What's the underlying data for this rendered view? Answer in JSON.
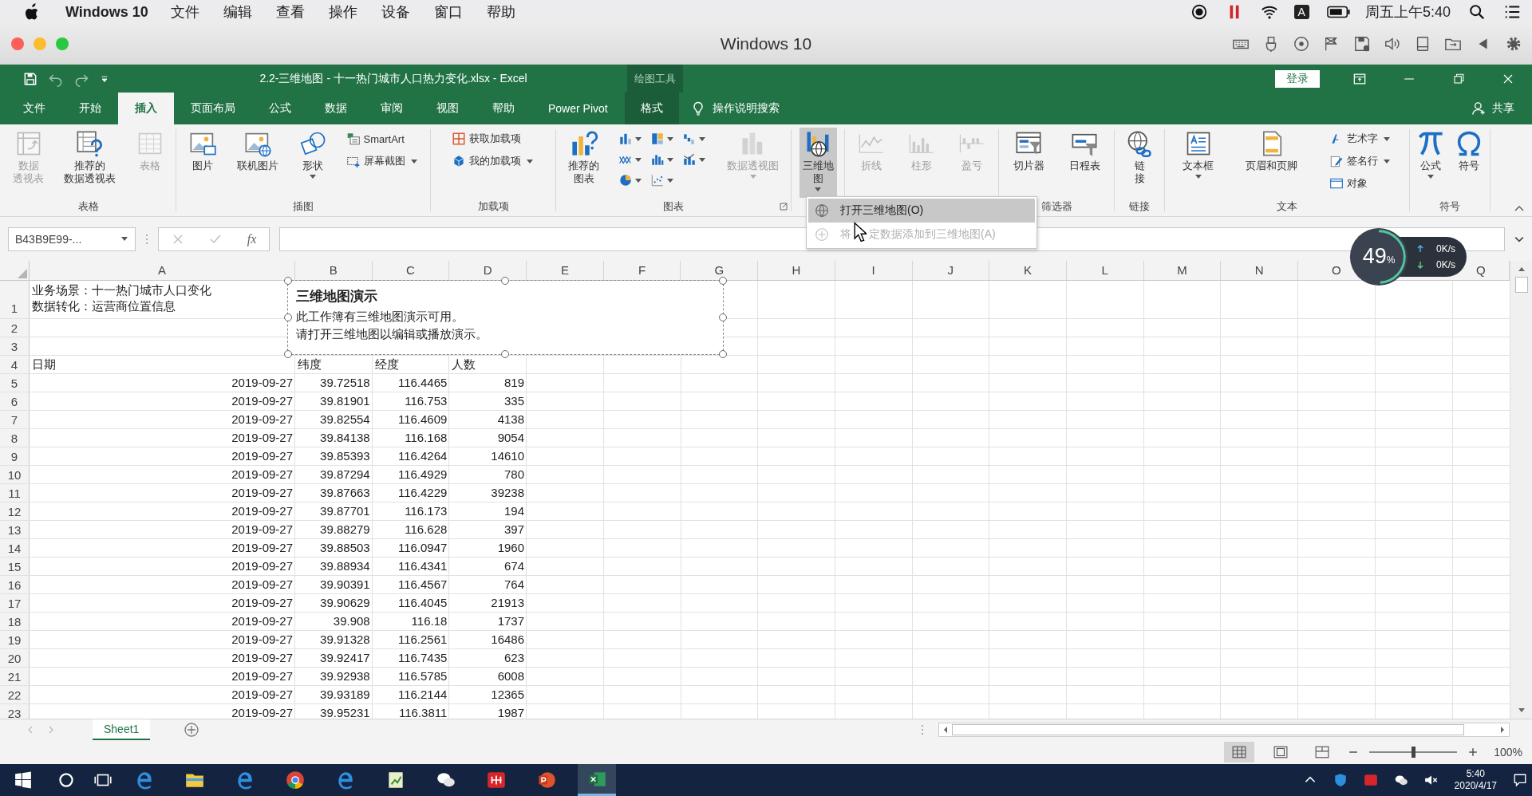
{
  "menu_bar": {
    "app": "Windows 10",
    "items": [
      "文件",
      "编辑",
      "查看",
      "操作",
      "设备",
      "窗口",
      "帮助"
    ],
    "input_source": "A",
    "clock": "周五上午5:40"
  },
  "mac_window": {
    "title": "Windows 10"
  },
  "excel": {
    "title": "2.2-三维地图 - 十一热门城市人口热力变化.xlsx - Excel",
    "context_title": "绘图工具",
    "sign_in": "登录",
    "tabs": [
      {
        "label": "文件",
        "selected": false,
        "contextual": false
      },
      {
        "label": "开始",
        "selected": false,
        "contextual": false
      },
      {
        "label": "插入",
        "selected": true,
        "contextual": false
      },
      {
        "label": "页面布局",
        "selected": false,
        "contextual": false
      },
      {
        "label": "公式",
        "selected": false,
        "contextual": false
      },
      {
        "label": "数据",
        "selected": false,
        "contextual": false
      },
      {
        "label": "审阅",
        "selected": false,
        "contextual": false
      },
      {
        "label": "视图",
        "selected": false,
        "contextual": false
      },
      {
        "label": "帮助",
        "selected": false,
        "contextual": false
      },
      {
        "label": "Power Pivot",
        "selected": false,
        "contextual": false
      },
      {
        "label": "格式",
        "selected": false,
        "contextual": true
      }
    ],
    "search_hint": "操作说明搜索",
    "share": "共享"
  },
  "ribbon": {
    "groups": [
      {
        "label": "表格",
        "items": [
          {
            "kind": "large",
            "lines": [
              "数据",
              "透视表"
            ],
            "disabled": true,
            "dropdown": false,
            "pressed": false
          },
          {
            "kind": "large",
            "lines": [
              "推荐的",
              "数据透视表"
            ],
            "disabled": false,
            "dropdown": false,
            "pressed": false
          },
          {
            "kind": "large",
            "lines": [
              "表格"
            ],
            "disabled": true,
            "dropdown": false,
            "pressed": false
          }
        ]
      },
      {
        "label": "插图",
        "items": [
          {
            "kind": "large",
            "lines": [
              "图片"
            ],
            "disabled": false,
            "dropdown": false,
            "pressed": false
          },
          {
            "kind": "large",
            "lines": [
              "联机图片"
            ],
            "disabled": false,
            "dropdown": false,
            "pressed": false
          },
          {
            "kind": "large",
            "lines": [
              "形状"
            ],
            "disabled": false,
            "dropdown": true,
            "pressed": false
          },
          {
            "kind": "small",
            "label": "SmartArt",
            "disabled": false,
            "dropdown": false,
            "pressed": false
          },
          {
            "kind": "small",
            "label": "屏幕截图",
            "disabled": false,
            "dropdown": true,
            "pressed": false
          }
        ]
      },
      {
        "label": "加载项",
        "items": [
          {
            "kind": "small",
            "label": "获取加载项",
            "disabled": false,
            "dropdown": false,
            "pressed": false
          },
          {
            "kind": "small",
            "label": "我的加载项",
            "disabled": false,
            "dropdown": true,
            "pressed": false
          }
        ]
      },
      {
        "label": "图表",
        "launcher": true,
        "items": [
          {
            "kind": "large",
            "lines": [
              "推荐的",
              "图表"
            ],
            "disabled": false,
            "dropdown": false,
            "pressed": false
          },
          {
            "kind": "icon",
            "disabled": false,
            "dropdown": true,
            "pressed": false
          },
          {
            "kind": "icon",
            "disabled": false,
            "dropdown": true,
            "pressed": false
          },
          {
            "kind": "icon",
            "disabled": false,
            "dropdown": true,
            "pressed": false
          },
          {
            "kind": "icon",
            "disabled": false,
            "dropdown": true,
            "pressed": false
          },
          {
            "kind": "icon",
            "disabled": false,
            "dropdown": true,
            "pressed": false
          },
          {
            "kind": "icon",
            "disabled": false,
            "dropdown": true,
            "pressed": false
          },
          {
            "kind": "icon",
            "disabled": false,
            "dropdown": true,
            "pressed": false
          },
          {
            "kind": "icon",
            "disabled": false,
            "dropdown": true,
            "pressed": false
          },
          {
            "kind": "large",
            "lines": [
              "数据透视图"
            ],
            "disabled": true,
            "dropdown": true,
            "pressed": false
          }
        ]
      },
      {
        "items": [
          {
            "kind": "large",
            "lines": [
              "三维地",
              "图"
            ],
            "disabled": false,
            "dropdown": true,
            "pressed": true
          }
        ]
      },
      {
        "items": [
          {
            "kind": "large",
            "lines": [
              "折线"
            ],
            "disabled": true,
            "dropdown": false,
            "pressed": false
          },
          {
            "kind": "large",
            "lines": [
              "柱形"
            ],
            "disabled": true,
            "dropdown": false,
            "pressed": false
          },
          {
            "kind": "large",
            "lines": [
              "盈亏"
            ],
            "disabled": true,
            "dropdown": false,
            "pressed": false
          }
        ]
      },
      {
        "label": "筛选器",
        "items": [
          {
            "kind": "large",
            "lines": [
              "切片器"
            ],
            "disabled": false,
            "dropdown": false,
            "pressed": false
          },
          {
            "kind": "large",
            "lines": [
              "日程表"
            ],
            "disabled": false,
            "dropdown": false,
            "pressed": false
          }
        ]
      },
      {
        "label": "链接",
        "items": [
          {
            "kind": "large",
            "lines": [
              "链",
              "接"
            ],
            "disabled": false,
            "dropdown": false,
            "pressed": false
          }
        ]
      },
      {
        "label": "文本",
        "items": [
          {
            "kind": "large",
            "lines": [
              "文本框"
            ],
            "disabled": false,
            "dropdown": true,
            "pressed": false
          },
          {
            "kind": "large",
            "lines": [
              "页眉和页脚"
            ],
            "disabled": false,
            "dropdown": false,
            "pressed": false
          },
          {
            "kind": "small",
            "label": "艺术字",
            "disabled": false,
            "dropdown": true,
            "pressed": false
          },
          {
            "kind": "small",
            "label": "签名行",
            "disabled": false,
            "dropdown": true,
            "pressed": false
          },
          {
            "kind": "small",
            "label": "对象",
            "disabled": false,
            "dropdown": false,
            "pressed": false
          }
        ]
      },
      {
        "label": "符号",
        "items": [
          {
            "kind": "large",
            "lines": [
              "公式"
            ],
            "disabled": false,
            "dropdown": true,
            "pressed": false
          },
          {
            "kind": "large",
            "lines": [
              "符号"
            ],
            "disabled": false,
            "dropdown": false,
            "pressed": false
          }
        ]
      }
    ]
  },
  "dropdown": {
    "items": [
      {
        "label_parts": [
          "打开三维地图(O)"
        ],
        "highlighted": true,
        "disabled": false
      },
      {
        "label_parts": [
          "将",
          "定数据添加到三维地图(A)"
        ],
        "highlighted": false,
        "disabled": true
      }
    ]
  },
  "formula_bar": {
    "name_box": "B43B9E99-...",
    "function_label": "fx"
  },
  "sheet": {
    "columns": [
      "A",
      "B",
      "C",
      "D",
      "E",
      "F",
      "G",
      "H",
      "I",
      "J",
      "K",
      "L",
      "M",
      "N",
      "O",
      "Q"
    ],
    "rows": [
      {
        "number": "1",
        "kind": "note",
        "lines": [
          "业务场景：十一热门城市人口变化",
          "数据转化：运营商位置信息"
        ]
      },
      {
        "number": "2",
        "kind": "blank"
      },
      {
        "number": "3",
        "kind": "blank"
      },
      {
        "number": "4",
        "kind": "header",
        "cells": [
          "日期",
          "纬度",
          "经度",
          "人数"
        ]
      },
      {
        "number": "5",
        "kind": "data",
        "cells": [
          "2019-09-27",
          "39.72518",
          "116.4465",
          "819"
        ]
      },
      {
        "number": "6",
        "kind": "data",
        "cells": [
          "2019-09-27",
          "39.81901",
          "116.753",
          "335"
        ]
      },
      {
        "number": "7",
        "kind": "data",
        "cells": [
          "2019-09-27",
          "39.82554",
          "116.4609",
          "4138"
        ]
      },
      {
        "number": "8",
        "kind": "data",
        "cells": [
          "2019-09-27",
          "39.84138",
          "116.168",
          "9054"
        ]
      },
      {
        "number": "9",
        "kind": "data",
        "cells": [
          "2019-09-27",
          "39.85393",
          "116.4264",
          "14610"
        ]
      },
      {
        "number": "10",
        "kind": "data",
        "cells": [
          "2019-09-27",
          "39.87294",
          "116.4929",
          "780"
        ]
      },
      {
        "number": "11",
        "kind": "data",
        "cells": [
          "2019-09-27",
          "39.87663",
          "116.4229",
          "39238"
        ]
      },
      {
        "number": "12",
        "kind": "data",
        "cells": [
          "2019-09-27",
          "39.87701",
          "116.173",
          "194"
        ]
      },
      {
        "number": "13",
        "kind": "data",
        "cells": [
          "2019-09-27",
          "39.88279",
          "116.628",
          "397"
        ]
      },
      {
        "number": "14",
        "kind": "data",
        "cells": [
          "2019-09-27",
          "39.88503",
          "116.0947",
          "1960"
        ]
      },
      {
        "number": "15",
        "kind": "data",
        "cells": [
          "2019-09-27",
          "39.88934",
          "116.4341",
          "674"
        ]
      },
      {
        "number": "16",
        "kind": "data",
        "cells": [
          "2019-09-27",
          "39.90391",
          "116.4567",
          "764"
        ]
      },
      {
        "number": "17",
        "kind": "data",
        "cells": [
          "2019-09-27",
          "39.90629",
          "116.4045",
          "21913"
        ]
      },
      {
        "number": "18",
        "kind": "data",
        "cells": [
          "2019-09-27",
          "39.908",
          "116.18",
          "1737"
        ]
      },
      {
        "number": "19",
        "kind": "data",
        "cells": [
          "2019-09-27",
          "39.91328",
          "116.2561",
          "16486"
        ]
      },
      {
        "number": "20",
        "kind": "data",
        "cells": [
          "2019-09-27",
          "39.92417",
          "116.7435",
          "623"
        ]
      },
      {
        "number": "21",
        "kind": "data",
        "cells": [
          "2019-09-27",
          "39.92938",
          "116.5785",
          "6008"
        ]
      },
      {
        "number": "22",
        "kind": "data",
        "cells": [
          "2019-09-27",
          "39.93189",
          "116.2144",
          "12365"
        ]
      },
      {
        "number": "23",
        "kind": "data",
        "cells": [
          "2019-09-27",
          "39.95231",
          "116.3811",
          "1987"
        ]
      }
    ],
    "shape": {
      "title": "三维地图演示",
      "lines": [
        "此工作簿有三维地图演示可用。",
        "请打开三维地图以编辑或播放演示。"
      ],
      "selected": true
    }
  },
  "monitor": {
    "percent": "49",
    "unit": "%",
    "level": 0.49,
    "upload": "0K/s",
    "download": "0K/s"
  },
  "sheet_tabs": [
    {
      "label": "Sheet1",
      "selected": true
    }
  ],
  "status_bar": {
    "views": [
      {
        "selected": true
      },
      {
        "selected": false
      },
      {
        "selected": false
      }
    ],
    "zoom": {
      "level": 0.5,
      "label": "100%"
    }
  },
  "taskbar": {
    "apps": [
      {
        "selected": false
      },
      {
        "selected": false
      },
      {
        "selected": false
      },
      {
        "selected": false
      },
      {
        "selected": false
      },
      {
        "selected": false
      },
      {
        "selected": false
      },
      {
        "selected": false
      },
      {
        "selected": false
      },
      {
        "selected": true
      }
    ],
    "time": "5:40",
    "date": "2020/4/17"
  }
}
